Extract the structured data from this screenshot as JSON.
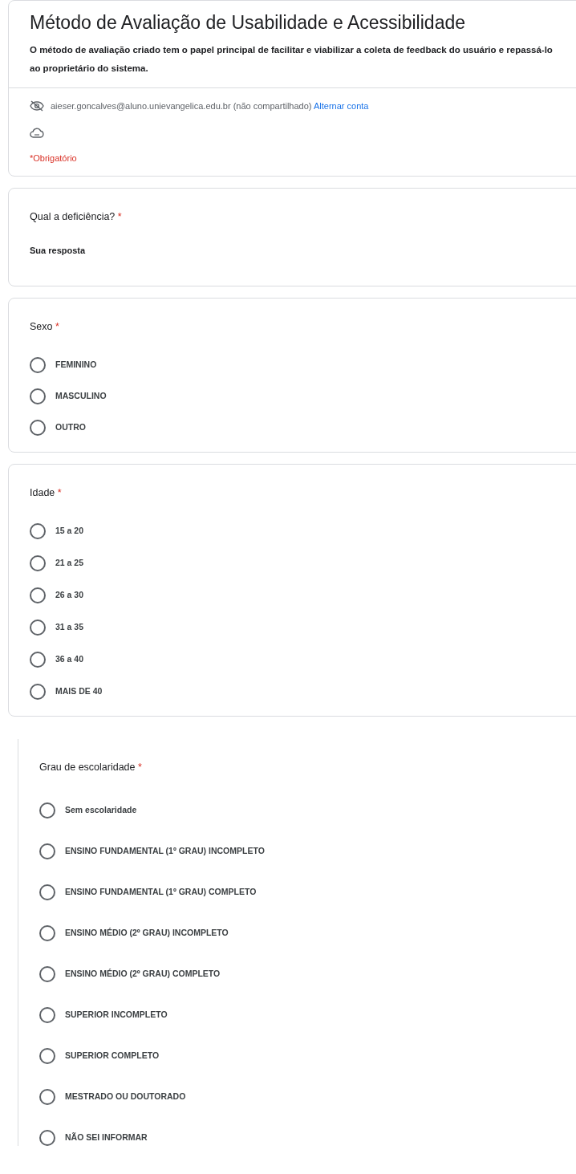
{
  "header": {
    "title": "Método de Avaliação de Usabilidade e Acessibilidade",
    "description": "O método de avaliação criado tem o papel principal de facilitar e viabilizar a coleta de feedback do usuário e repassá-lo ao proprietário do sistema.",
    "account": {
      "email": "aieser.goncalves@aluno.unievangelica.edu.br",
      "note": "(não compartilhado)",
      "switch_link": "Alternar conta"
    },
    "required_note": "*Obrigatório"
  },
  "questions": [
    {
      "kind": "text",
      "label": "Qual a deficiência?",
      "required_mark": "*",
      "placeholder": "Sua resposta"
    },
    {
      "kind": "radio",
      "label": "Sexo",
      "required_mark": "*",
      "options": [
        {
          "label": "FEMININO",
          "selected": false
        },
        {
          "label": "MASCULINO",
          "selected": false
        },
        {
          "label": "OUTRO",
          "selected": false
        }
      ]
    },
    {
      "kind": "radio",
      "label": "Idade",
      "required_mark": "*",
      "options": [
        {
          "label": "15 a 20",
          "selected": false
        },
        {
          "label": "21 a 25",
          "selected": false
        },
        {
          "label": "26 a 30",
          "selected": false
        },
        {
          "label": "31 a 35",
          "selected": false
        },
        {
          "label": "36 a 40",
          "selected": false
        },
        {
          "label": "MAIS DE 40",
          "selected": false
        }
      ]
    },
    {
      "kind": "radio_wide",
      "label": "Grau de escolaridade",
      "required_mark": "*",
      "options": [
        {
          "label": "Sem escolaridade",
          "selected": false
        },
        {
          "label": "ENSINO FUNDAMENTAL (1º GRAU) INCOMPLETO",
          "selected": false
        },
        {
          "label": "ENSINO FUNDAMENTAL (1º GRAU) COMPLETO",
          "selected": false
        },
        {
          "label": "ENSINO MÉDIO (2º GRAU) INCOMPLETO",
          "selected": false
        },
        {
          "label": "ENSINO MÉDIO (2º GRAU) COMPLETO",
          "selected": false
        },
        {
          "label": "SUPERIOR INCOMPLETO",
          "selected": false
        },
        {
          "label": "SUPERIOR COMPLETO",
          "selected": false
        },
        {
          "label": "MESTRADO OU DOUTORADO",
          "selected": false
        },
        {
          "label": "NÃO SEI INFORMAR",
          "selected": false
        }
      ]
    }
  ]
}
